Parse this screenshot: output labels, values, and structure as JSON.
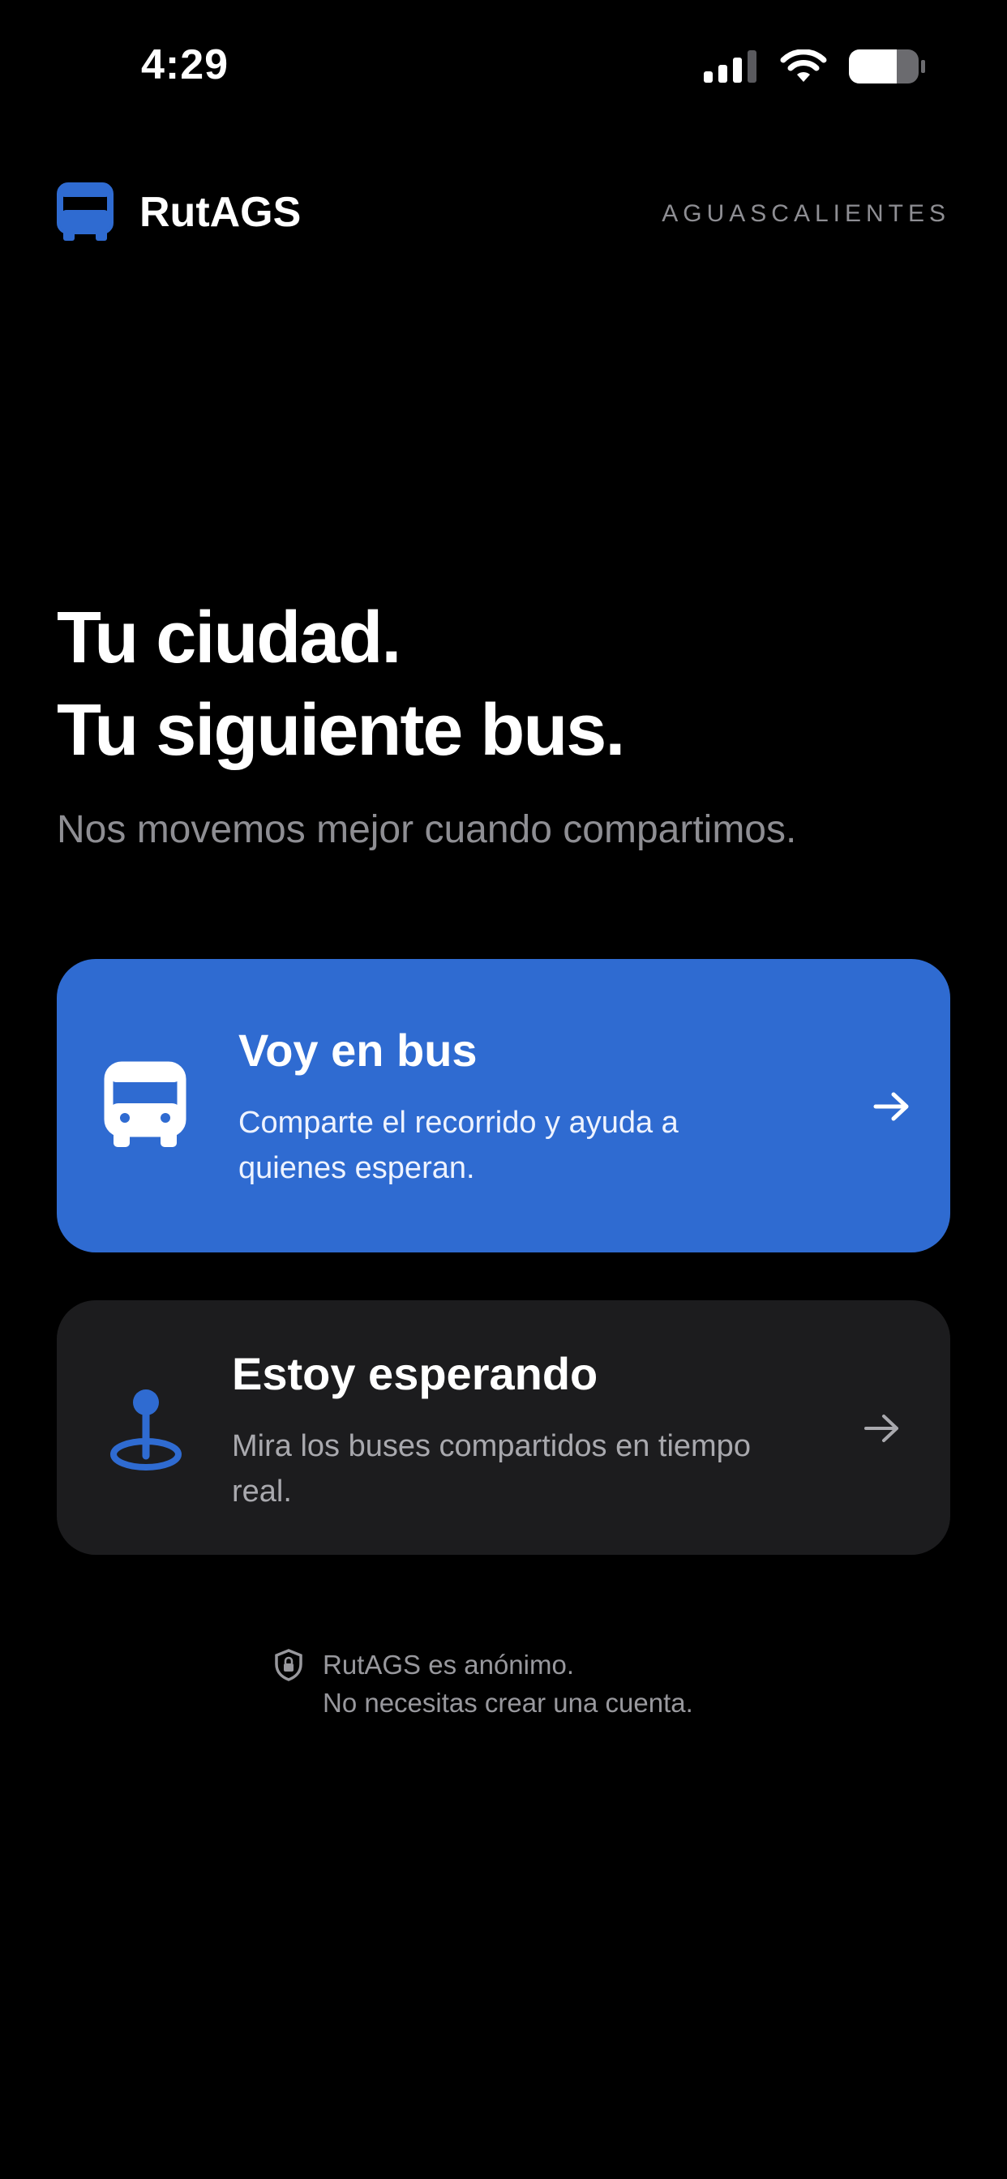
{
  "status_bar": {
    "time": "4:29"
  },
  "header": {
    "app_name": "RutAGS",
    "city": "AGUASCALIENTES",
    "logo_icon": "bus-icon"
  },
  "hero": {
    "title_line1": "Tu ciudad.",
    "title_line2": "Tu siguiente bus.",
    "subtitle": "Nos movemos mejor cuando compartimos."
  },
  "options": {
    "on_bus": {
      "title": "Voy en bus",
      "description": "Comparte el recorrido y ayuda a quienes esperan.",
      "icon": "bus-front-icon",
      "arrow_icon": "arrow-right-icon"
    },
    "waiting": {
      "title": "Estoy esperando",
      "description": "Mira los buses compartidos en tiempo real.",
      "icon": "location-pin-icon",
      "arrow_icon": "arrow-right-icon"
    }
  },
  "footer": {
    "privacy_line1": "RutAGS es anónimo.",
    "privacy_line2": "No necesitas crear una cuenta.",
    "icon": "shield-lock-icon"
  },
  "colors": {
    "background": "#000000",
    "accent": "#2f6bd1",
    "card_dark": "#1c1c1e",
    "muted_text": "#8e8e93"
  }
}
